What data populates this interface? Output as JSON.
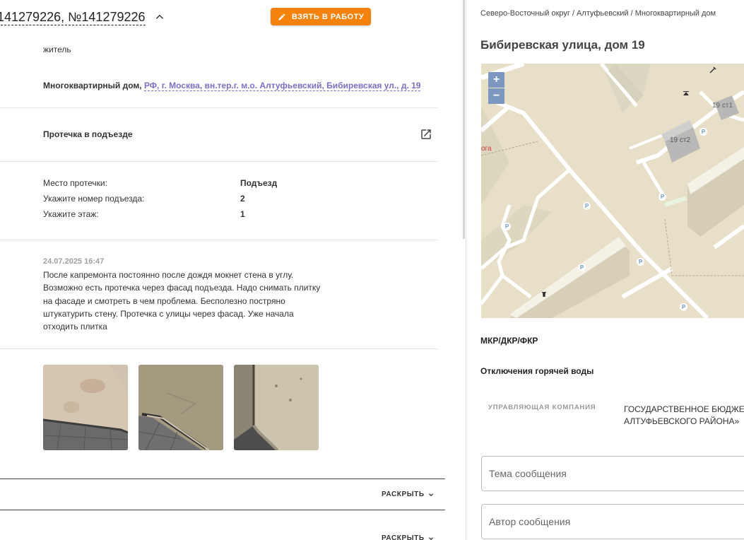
{
  "ticket": {
    "title": "141279226, №141279226",
    "take_button": "ВЗЯТЬ В РАБОТУ"
  },
  "applicant": {
    "role": "житель",
    "address_label": "Многоквартирный дом,",
    "address_link": "РФ, г. Москва, вн.тер.г. м.о. Алтуфьевский, Бибиревская ул., д. 19"
  },
  "category": {
    "title": "Протечка в подъезде"
  },
  "details": [
    {
      "label": "Место протечки:",
      "value": "Подъезд"
    },
    {
      "label": "Укажите номер подъезда:",
      "value": "2"
    },
    {
      "label": "Укажите этаж:",
      "value": "1"
    }
  ],
  "message": {
    "date": "24.07.2025 16:47",
    "lines": [
      "После капремонта постоянно после дождя мокнет стена в углу.",
      "Возможно есть протечка через фасад подъезда. Надо снимать плитку",
      "на фасаде и смотреть в чем проблема. Бесполезно постряно",
      "штукатурить стену. Протечка с улицы через фасад. Уже начала",
      "отходить плитка"
    ]
  },
  "sections": [
    {
      "expand_label": "РАСКРЫТЬ"
    },
    {
      "expand_label": "РАСКРЫТЬ"
    }
  ],
  "right": {
    "breadcrumb": "Северо-Восточный округ / Алтуфьевский / Многоквартирный дом",
    "house_title": "Бибиревская улица, дом 19",
    "map": {
      "zoom_in": "+",
      "zoom_out": "−",
      "building_1": "19 ст1",
      "building_2": "19 ст2",
      "edge_label": "ога",
      "parking": "P"
    },
    "mkr_heading": "МКР/ДКР/ФКР",
    "hot_water_heading": "Отключения горячей воды",
    "uk_label": "УПРАВЛЯЮЩАЯ КОМПАНИЯ",
    "uk_value_line1": "ГОСУДАРСТВЕННОЕ БЮДЖЕТНОЕ",
    "uk_value_line2": "АЛТУФЬЕВСКОГО РАЙОНА»",
    "subject_placeholder": "Тема сообщения",
    "author_placeholder": "Автор сообщения"
  },
  "colors": {
    "accent": "#f5820d",
    "link": "#7b6fc9",
    "map_bg": "#e8dfc8"
  }
}
